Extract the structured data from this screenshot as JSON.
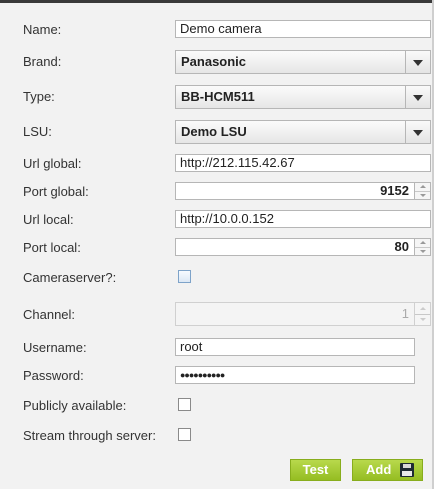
{
  "form": {
    "name": {
      "label": "Name:",
      "value": "Demo camera"
    },
    "brand": {
      "label": "Brand:",
      "value": "Panasonic"
    },
    "type": {
      "label": "Type:",
      "value": "BB-HCM511"
    },
    "lsu": {
      "label": "LSU:",
      "value": "Demo LSU"
    },
    "url_global": {
      "label": "Url global:",
      "value": "http://212.115.42.67"
    },
    "port_global": {
      "label": "Port global:",
      "value": "9152"
    },
    "url_local": {
      "label": "Url local:",
      "value": "http://10.0.0.152"
    },
    "port_local": {
      "label": "Port local:",
      "value": "80"
    },
    "cameraserver": {
      "label": "Cameraserver?:",
      "checked": false
    },
    "channel": {
      "label": "Channel:",
      "value": "1",
      "disabled": true
    },
    "username": {
      "label": "Username:",
      "value": "root"
    },
    "password": {
      "label": "Password:",
      "value": "●●●●●●●●●●"
    },
    "publicly_available": {
      "label": "Publicly available:",
      "checked": false
    },
    "stream_through_server": {
      "label": "Stream through server:",
      "checked": false
    }
  },
  "buttons": {
    "test": "Test",
    "add": "Add"
  },
  "icons": {
    "select_arrow": "chevron-down-icon",
    "save": "floppy-disk-icon",
    "spinner": "spinner-arrows-icon"
  },
  "colors": {
    "button_green": "#a6cb36",
    "background": "#f2f2f2",
    "checkbox_blue": "#7ea3c9"
  }
}
